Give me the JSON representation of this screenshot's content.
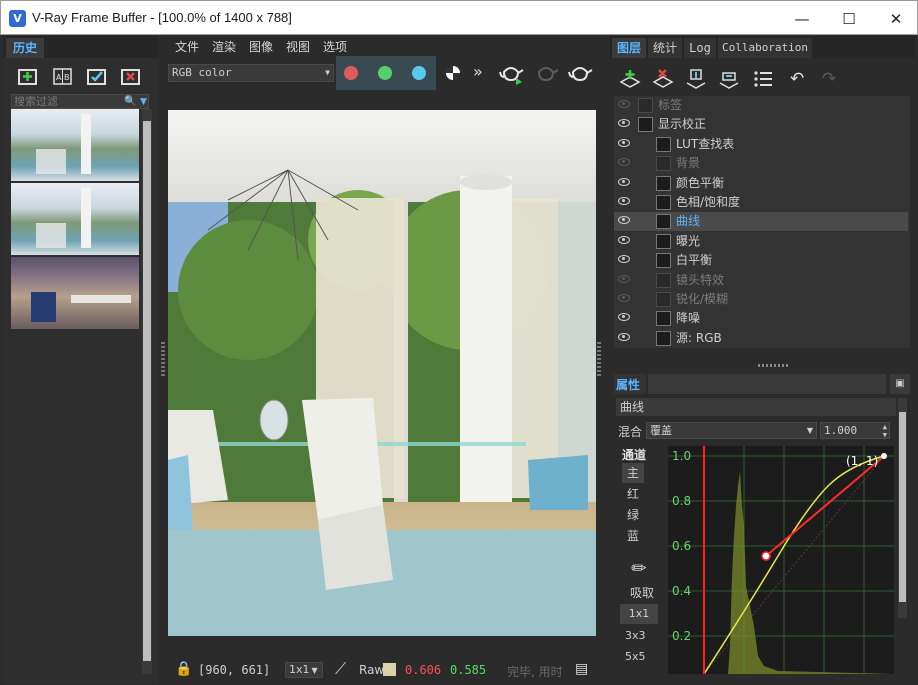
{
  "window": {
    "title": "V-Ray Frame Buffer - [100.0% of 1400 x 788]",
    "icon": "V",
    "minimize": "—",
    "maximize": "☐",
    "close": "✕"
  },
  "history": {
    "tab": "历史",
    "filter_placeholder": "搜索过滤",
    "thumbnails": 3
  },
  "menu": [
    "文件",
    "渲染",
    "图像",
    "视图",
    "选项"
  ],
  "toolbar": {
    "channel": "RGB color",
    "colors": {
      "red": "#e05a5a",
      "green": "#56d06a",
      "blue": "#58c8f0"
    }
  },
  "statusbar": {
    "coords": "[960, 661]",
    "zoom": "1x1",
    "raw_label": "Raw",
    "r_value": "0.606",
    "g_value": "0.585",
    "status_text": "完毕, 用时"
  },
  "right_tabs": [
    "图层",
    "统计",
    "Log",
    "Collaboration"
  ],
  "layers": [
    {
      "label": "标签",
      "visible": false,
      "indent": 0
    },
    {
      "label": "显示校正",
      "visible": true,
      "indent": 0
    },
    {
      "label": "LUT查找表",
      "visible": true,
      "indent": 1
    },
    {
      "label": "背景",
      "visible": false,
      "indent": 1
    },
    {
      "label": "颜色平衡",
      "visible": true,
      "indent": 1
    },
    {
      "label": "色相/饱和度",
      "visible": true,
      "indent": 1
    },
    {
      "label": "曲线",
      "visible": true,
      "indent": 1,
      "selected": true
    },
    {
      "label": "曝光",
      "visible": true,
      "indent": 1
    },
    {
      "label": "白平衡",
      "visible": true,
      "indent": 1
    },
    {
      "label": "镜头特效",
      "visible": false,
      "indent": 1
    },
    {
      "label": "锐化/模糊",
      "visible": false,
      "indent": 1
    },
    {
      "label": "降噪",
      "visible": true,
      "indent": 1
    },
    {
      "label": "源: RGB",
      "visible": true,
      "indent": 1
    }
  ],
  "properties": {
    "header": "属性",
    "layer_name": "曲线",
    "blend_label": "混合",
    "blend_mode": "覆盖",
    "opacity": "1.000",
    "channel_label": "通道",
    "channels": [
      "主",
      "红",
      "绿",
      "蓝"
    ],
    "pick_label": "吸取",
    "sample_sizes": [
      "1x1",
      "3x3",
      "5x5"
    ],
    "curve_point_label": "(1, 1)",
    "y_ticks": [
      "1.0",
      "0.8",
      "0.6",
      "0.4",
      "0.2"
    ]
  }
}
